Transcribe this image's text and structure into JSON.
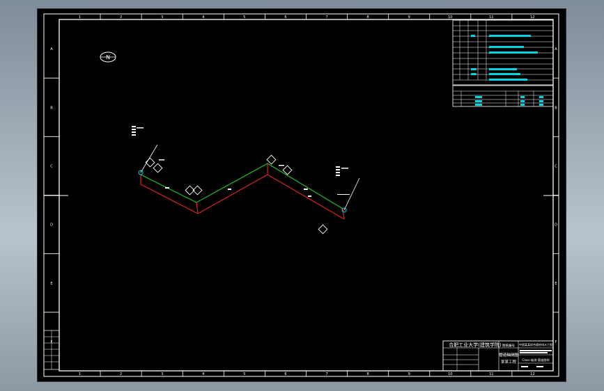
{
  "sheet": {
    "columns": [
      "1",
      "2",
      "3",
      "4",
      "5",
      "6",
      "7",
      "8",
      "9",
      "10",
      "11",
      "12"
    ],
    "rows": [
      "A",
      "B",
      "C",
      "D",
      "E",
      "F"
    ]
  },
  "north_symbol": "N",
  "title_block": {
    "school": "合肥工业大学(建筑学院)",
    "sheet_no": "图纸编号",
    "project": "中国某某综合楼给排水工程",
    "drawing_title": "管道轴测图",
    "project_sub": "某某工程",
    "drawing_type": "Class-轴测-管道图例"
  },
  "colors": {
    "frame": "#ffffff",
    "pipe_hot": "#e02020",
    "pipe_cold": "#20c020",
    "text_cyan": "#00d5e0",
    "background": "#000000"
  },
  "icons": [
    "north-arrow-icon",
    "valve-tag-icon",
    "elbow-tag-icon"
  ]
}
